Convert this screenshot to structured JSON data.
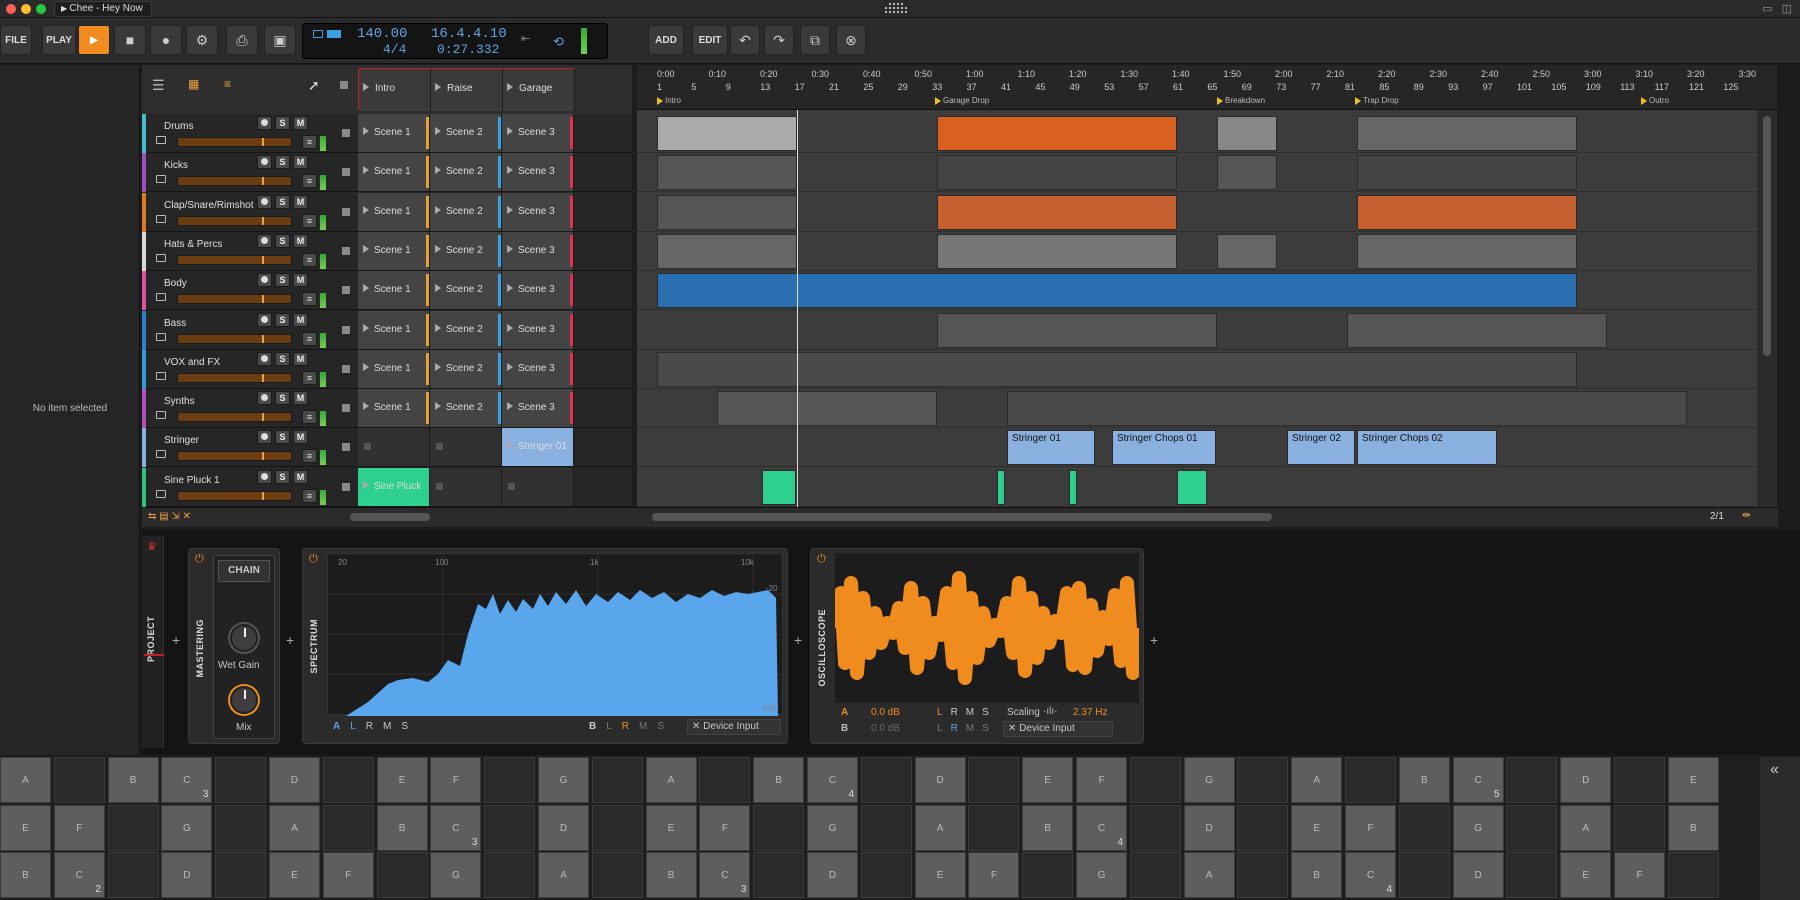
{
  "window": {
    "title": "Chee - Hey Now"
  },
  "toolbar": {
    "file_label": "FILE",
    "play_label": "PLAY",
    "add_label": "ADD",
    "edit_label": "EDIT",
    "tempo": "140.00",
    "time_sig": "4/4",
    "position_bars": "16.4.4.10",
    "position_time": "0:27.332"
  },
  "inspector": {
    "empty_text": "No item selected"
  },
  "scene_headers": [
    "Intro",
    "Raise",
    "Garage"
  ],
  "tracks": [
    {
      "name": "Drums",
      "color": "#3fc0c8",
      "scenes": [
        "Scene 1",
        "Scene 2",
        "Scene 3"
      ]
    },
    {
      "name": "Kicks",
      "color": "#9a4fc0",
      "scenes": [
        "Scene 1",
        "Scene 2",
        "Scene 3"
      ]
    },
    {
      "name": "Clap/Snare/Rimshot",
      "color": "#e07a20",
      "scenes": [
        "Scene 1",
        "Scene 2",
        "Scene 3"
      ]
    },
    {
      "name": "Hats & Percs",
      "color": "#d8d8d8",
      "scenes": [
        "Scene 1",
        "Scene 2",
        "Scene 3"
      ]
    },
    {
      "name": "Body",
      "color": "#e050a0",
      "scenes": [
        "Scene 1",
        "Scene 2",
        "Scene 3"
      ]
    },
    {
      "name": "Bass",
      "color": "#2a7fd0",
      "scenes": [
        "Scene 1",
        "Scene 2",
        "Scene 3"
      ]
    },
    {
      "name": "VOX and FX",
      "color": "#3a9ad8",
      "scenes": [
        "Scene 1",
        "Scene 2",
        "Scene 3"
      ]
    },
    {
      "name": "Synths",
      "color": "#b050c0",
      "scenes": [
        "Scene 1",
        "Scene 2",
        "Scene 3"
      ]
    },
    {
      "name": "Stringer",
      "color": "#8ab0e0",
      "scenes": [
        "",
        "",
        "Stringer 01"
      ]
    },
    {
      "name": "Sine Pluck 1",
      "color": "#30c080",
      "scenes": [
        "Sine Pluck",
        "",
        ""
      ]
    }
  ],
  "ruler": {
    "times": [
      "0:00",
      "0:10",
      "0:20",
      "0:30",
      "0:40",
      "0:50",
      "1:00",
      "1:10",
      "1:20",
      "1:30",
      "1:40",
      "1:50",
      "2:00",
      "2:10",
      "2:20",
      "2:30",
      "2:40",
      "2:50",
      "3:00",
      "3:10",
      "3:20",
      "3:30"
    ],
    "bars": [
      "1",
      "5",
      "9",
      "13",
      "17",
      "21",
      "25",
      "29",
      "33",
      "37",
      "41",
      "45",
      "49",
      "53",
      "57",
      "61",
      "65",
      "69",
      "73",
      "77",
      "81",
      "85",
      "89",
      "93",
      "97",
      "101",
      "105",
      "109",
      "113",
      "117",
      "121",
      "125"
    ],
    "markers": [
      "Intro",
      "Garage Drop",
      "Breakdown",
      "Trap Drop",
      "Outro"
    ]
  },
  "arranger_clips": {
    "stringer": [
      "Stringer 01",
      "Stringer Chops 01",
      "Stringer 02",
      "Stringer Chops 02"
    ]
  },
  "arranger_footer": {
    "zoom": "2/1"
  },
  "devices": {
    "project_label": "PROJECT",
    "mastering_label": "MASTERING",
    "chain_label": "CHAIN",
    "wet_gain_label": "Wet Gain",
    "mix_label": "Mix",
    "spectrum_label": "SPECTRUM",
    "spectrum_freqs": [
      "20",
      "100",
      "1k",
      "10k"
    ],
    "spectrum_db_top": "-20",
    "spectrum_db_bottom": "-100",
    "spectrum_channels": [
      "A",
      "L",
      "R",
      "M",
      "S"
    ],
    "spectrum_b_channels": [
      "B",
      "L",
      "R",
      "M",
      "S"
    ],
    "device_input": "Device Input",
    "oscilloscope_label": "OSCILLOSCOPE",
    "osc_a_db": "0.0 dB",
    "osc_b_db": "0.0 dB",
    "scaling_label": "Scaling",
    "scaling_value": "2.37 Hz"
  },
  "keyboard": {
    "row1": [
      [
        "A",
        ""
      ],
      [
        "",
        ""
      ],
      [
        "B",
        ""
      ],
      [
        "C",
        "3"
      ],
      [
        "",
        ""
      ],
      [
        "D",
        ""
      ],
      [
        "",
        ""
      ],
      [
        "E",
        ""
      ],
      [
        "F",
        ""
      ],
      [
        "",
        ""
      ],
      [
        "G",
        ""
      ],
      [
        "",
        ""
      ],
      [
        "A",
        ""
      ],
      [
        "",
        ""
      ],
      [
        "B",
        ""
      ],
      [
        "C",
        "4"
      ],
      [
        "",
        ""
      ],
      [
        "D",
        ""
      ],
      [
        "",
        ""
      ],
      [
        "E",
        ""
      ],
      [
        "F",
        ""
      ],
      [
        "",
        ""
      ],
      [
        "G",
        ""
      ],
      [
        "",
        ""
      ],
      [
        "A",
        ""
      ],
      [
        "",
        ""
      ],
      [
        "B",
        ""
      ],
      [
        "C",
        "5"
      ],
      [
        "",
        ""
      ],
      [
        "D",
        ""
      ],
      [
        "",
        ""
      ],
      [
        "E",
        ""
      ]
    ],
    "row2": [
      [
        "E",
        ""
      ],
      [
        "F",
        ""
      ],
      [
        "",
        ""
      ],
      [
        "G",
        ""
      ],
      [
        "",
        ""
      ],
      [
        "A",
        ""
      ],
      [
        "",
        ""
      ],
      [
        "B",
        ""
      ],
      [
        "C",
        "3"
      ],
      [
        "",
        ""
      ],
      [
        "D",
        ""
      ],
      [
        "",
        ""
      ],
      [
        "E",
        ""
      ],
      [
        "F",
        ""
      ],
      [
        "",
        ""
      ],
      [
        "G",
        ""
      ],
      [
        "",
        ""
      ],
      [
        "A",
        ""
      ],
      [
        "",
        ""
      ],
      [
        "B",
        ""
      ],
      [
        "C",
        "4"
      ],
      [
        "",
        ""
      ],
      [
        "D",
        ""
      ],
      [
        "",
        ""
      ],
      [
        "E",
        ""
      ],
      [
        "F",
        ""
      ],
      [
        "",
        ""
      ],
      [
        "G",
        ""
      ],
      [
        "",
        ""
      ],
      [
        "A",
        ""
      ],
      [
        "",
        ""
      ],
      [
        "B",
        ""
      ]
    ],
    "row3": [
      [
        "B",
        ""
      ],
      [
        "C",
        "2"
      ],
      [
        "",
        ""
      ],
      [
        "D",
        ""
      ],
      [
        "",
        ""
      ],
      [
        "E",
        ""
      ],
      [
        "F",
        ""
      ],
      [
        "",
        ""
      ],
      [
        "G",
        ""
      ],
      [
        "",
        ""
      ],
      [
        "A",
        ""
      ],
      [
        "",
        ""
      ],
      [
        "B",
        ""
      ],
      [
        "C",
        "3"
      ],
      [
        "",
        ""
      ],
      [
        "D",
        ""
      ],
      [
        "",
        ""
      ],
      [
        "E",
        ""
      ],
      [
        "F",
        ""
      ],
      [
        "",
        ""
      ],
      [
        "G",
        ""
      ],
      [
        "",
        ""
      ],
      [
        "A",
        ""
      ],
      [
        "",
        ""
      ],
      [
        "B",
        ""
      ],
      [
        "C",
        "4"
      ],
      [
        "",
        ""
      ],
      [
        "D",
        ""
      ],
      [
        "",
        ""
      ],
      [
        "E",
        ""
      ],
      [
        "F",
        ""
      ],
      [
        "",
        ""
      ]
    ]
  }
}
